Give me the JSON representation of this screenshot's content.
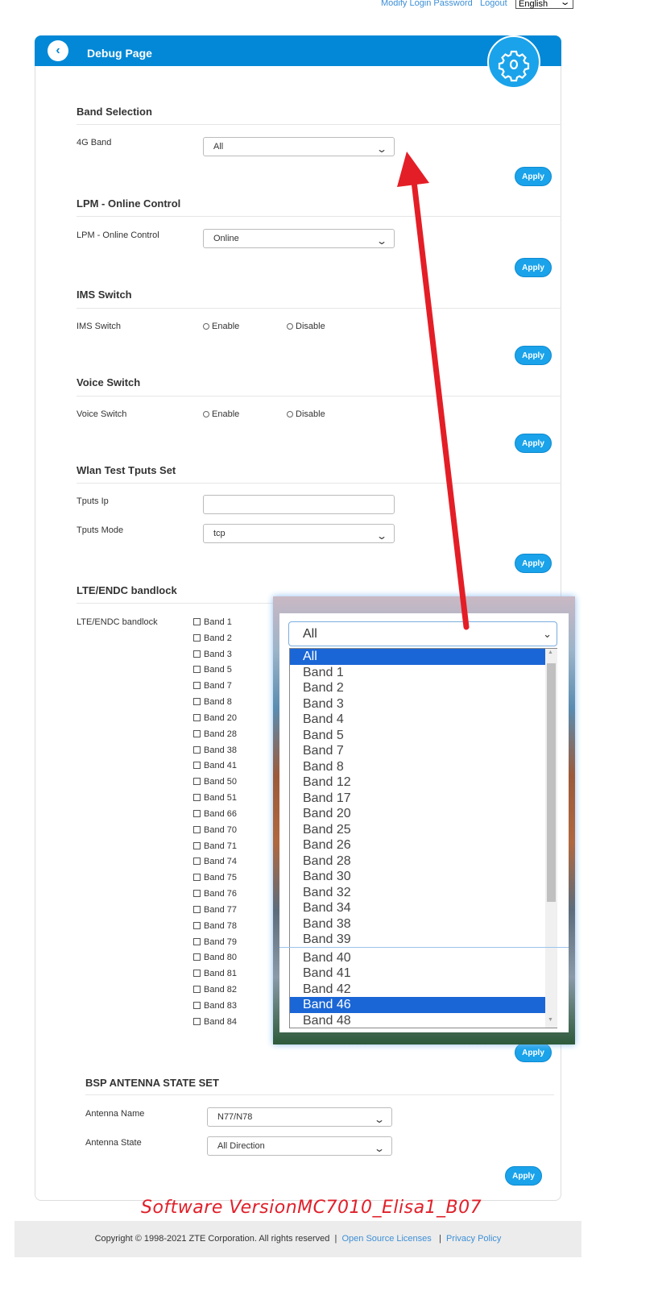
{
  "top_bar": {
    "modify_password": "Modify Login Password",
    "logout": "Logout",
    "language": "English"
  },
  "header": {
    "title": "Debug Page"
  },
  "band_selection": {
    "title": "Band Selection",
    "label": "4G Band",
    "value": "All",
    "apply": "Apply"
  },
  "lpm": {
    "title": "LPM - Online Control",
    "label": "LPM - Online Control",
    "value": "Online",
    "apply": "Apply"
  },
  "ims": {
    "title": "IMS Switch",
    "label": "IMS Switch",
    "enable": "Enable",
    "disable": "Disable",
    "apply": "Apply"
  },
  "voice": {
    "title": "Voice Switch",
    "label": "Voice Switch",
    "enable": "Enable",
    "disable": "Disable",
    "apply": "Apply"
  },
  "wlan": {
    "title": "Wlan Test Tputs Set",
    "ip_label": "Tputs Ip",
    "ip_value": "",
    "mode_label": "Tputs Mode",
    "mode_value": "tcp",
    "apply": "Apply"
  },
  "bandlock": {
    "title": "LTE/ENDC bandlock",
    "label": "LTE/ENDC bandlock",
    "bands": [
      "Band 1",
      "Band 2",
      "Band 3",
      "Band 5",
      "Band 7",
      "Band 8",
      "Band 20",
      "Band 28",
      "Band 38",
      "Band 41",
      "Band 50",
      "Band 51",
      "Band 66",
      "Band 70",
      "Band 71",
      "Band 74",
      "Band 75",
      "Band 76",
      "Band 77",
      "Band 78",
      "Band 79",
      "Band 80",
      "Band 81",
      "Band 82",
      "Band 83",
      "Band 84"
    ],
    "apply": "Apply"
  },
  "bsp": {
    "title": "BSP ANTENNA STATE SET",
    "name_label": "Antenna Name",
    "name_value": "N77/N78",
    "state_label": "Antenna State",
    "state_value": "All Direction",
    "apply": "Apply"
  },
  "dropdown_overlay": {
    "selected": "All",
    "options": [
      "All",
      "Band 1",
      "Band 2",
      "Band 3",
      "Band 4",
      "Band 5",
      "Band 7",
      "Band 8",
      "Band 12",
      "Band 17",
      "Band 20",
      "Band 25",
      "Band 26",
      "Band 28",
      "Band 30",
      "Band 32",
      "Band 34",
      "Band 38",
      "Band 39",
      "Band 40",
      "Band 41",
      "Band 42",
      "Band 46",
      "Band 48"
    ],
    "highlighted": [
      "All",
      "Band 46"
    ]
  },
  "annotation": {
    "text": "Software VersionMC7010_Elisa1_B07",
    "color": "#e0202a"
  },
  "footer": {
    "copyright": "Copyright © 1998-2021 ZTE Corporation. All rights reserved",
    "sep": "|",
    "open_source": "Open Source Licenses",
    "privacy": "Privacy Policy"
  },
  "colors": {
    "header": "#0288d6",
    "button": "#1aa3ea",
    "link": "#3d8fd6",
    "highlight": "#1a66d6"
  }
}
